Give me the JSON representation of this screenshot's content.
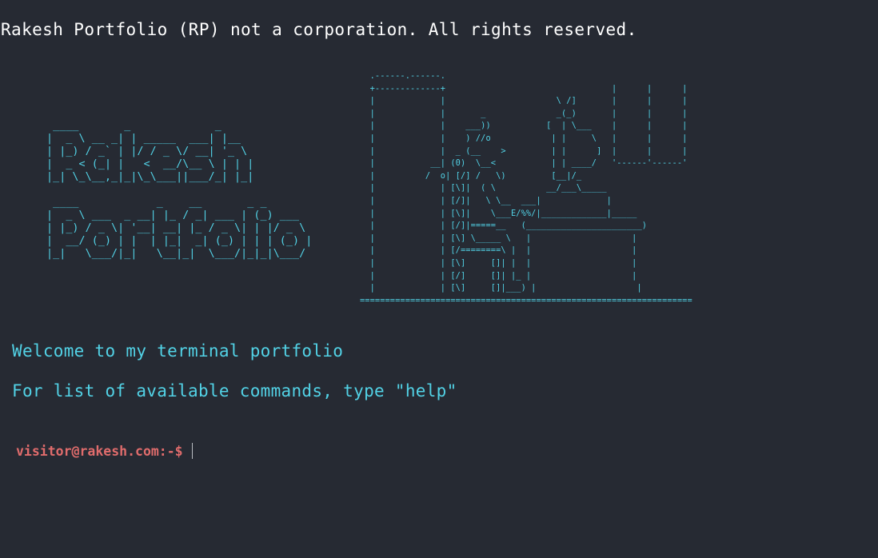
{
  "copyright": "Rakesh Portfolio (RP) not a corporation. All rights reserved.",
  "ascii_title": " ____       _             _     \n|  _ \\ __ _| | _____  ___| |__  \n| |_) / _` | |/ / _ \\/ __| '_ \\ \n|  _ < (_| |   <  __/\\__ \\ | | |\n|_| \\_\\__,_|_|\\_\\___||___/_| |_|\n\n ____            _    __       _ _       \n|  _ \\ ___  _ __| |_ / _| ___ | (_) ___  \n| |_) / _ \\| '__| __| |_ / _ \\| | |/ _ \\ \n|  __/ (_) | |  | |_|  _| (_) | | | (_) |\n|_|   \\___/|_|   \\__|_|  \\___/|_|_|\\___/ ",
  "ascii_scene": "  .------.------.\n  +-------------+                                 |      |      |\n  |             |                      \\ /]       |      |      |\n  |             |       _              _(_)       |      |      |\n  |             |    ___))           [  | \\___    |      |      |\n  |             |    ) //o            | |     \\   |      |      |\n  |             |  _ (__    >         | |      ]  |      |      |\n  |           __| (0)  \\__<           | | ____/   '------'------'\n  |          /  o| [/] /   \\)         [__|/_\n  |             | [\\]|  ( \\          __/___\\_____\n  |             | [/]|   \\ \\__  ___|             |\n  |             | [\\]|    \\___E/%%/|_____________|_____\n  |             | [/]|=====__   (_______________________)\n  |             | [\\] \\_____ \\   |                    |\n  |             | [/========\\ |  |                    |\n  |             | [\\]     []| |  |                    |\n  |             | [/]     []| |_ |                    |\n  |             | [\\]     []|___) |                    |\n==================================================================",
  "welcome_line1": "Welcome to my terminal portfolio",
  "welcome_line2": "For list of available commands, type \"help\"",
  "prompt": "visitor@rakesh.com:-$",
  "command_value": "",
  "colors": {
    "background": "#262a33",
    "accent_cyan": "#52d2e6",
    "prompt_red": "#e06c6c",
    "text_white": "#ffffff"
  }
}
